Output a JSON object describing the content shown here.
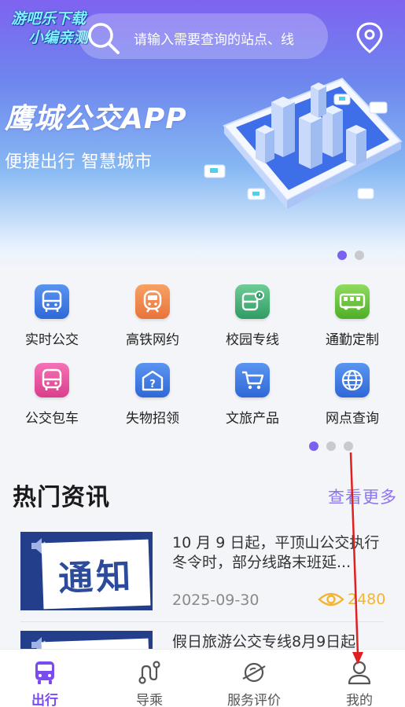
{
  "watermark": {
    "line1": "游吧乐下载",
    "line2": "小编亲测"
  },
  "search": {
    "placeholder": "请输入需要查询的站点、线"
  },
  "banner": {
    "title": "鹰城公交APP",
    "subtitle": "便捷出行 智慧城市"
  },
  "services": [
    {
      "label": "实时公交",
      "icon": "bus-icon",
      "color": "#3f7fe8"
    },
    {
      "label": "高铁网约",
      "icon": "train-icon",
      "color": "#f08a4b"
    },
    {
      "label": "校园专线",
      "icon": "school-bus-icon",
      "color": "#48b37a"
    },
    {
      "label": "通勤定制",
      "icon": "commuter-bus-icon",
      "color": "#6cc23f"
    },
    {
      "label": "公交包车",
      "icon": "charter-bus-icon",
      "color": "#e84f9c"
    },
    {
      "label": "失物招领",
      "icon": "lost-found-icon",
      "color": "#3f7fe8"
    },
    {
      "label": "文旅产品",
      "icon": "cart-icon",
      "color": "#3f7fe8"
    },
    {
      "label": "网点查询",
      "icon": "globe-icon",
      "color": "#3f7fe8"
    }
  ],
  "news": {
    "heading": "热门资讯",
    "more": "查看更多",
    "items": [
      {
        "thumb_text": "通知",
        "title": "10 月 9 日起，平顶山公交执行冬令时，部分线路末班延...",
        "date": "2025-09-30",
        "views": "2480"
      },
      {
        "thumb_text": "",
        "title": "假日旅游公交专线8月9日起",
        "date": "",
        "views": ""
      }
    ]
  },
  "tabs": [
    {
      "label": "出行",
      "icon": "bus-icon",
      "active": true
    },
    {
      "label": "导乘",
      "icon": "route-icon",
      "active": false
    },
    {
      "label": "服务评价",
      "icon": "planet-icon",
      "active": false
    },
    {
      "label": "我的",
      "icon": "user-icon",
      "active": false
    }
  ],
  "colors": {
    "accent": "#7b4bf0",
    "views": "#f2b531",
    "annotation": "#e02020"
  }
}
